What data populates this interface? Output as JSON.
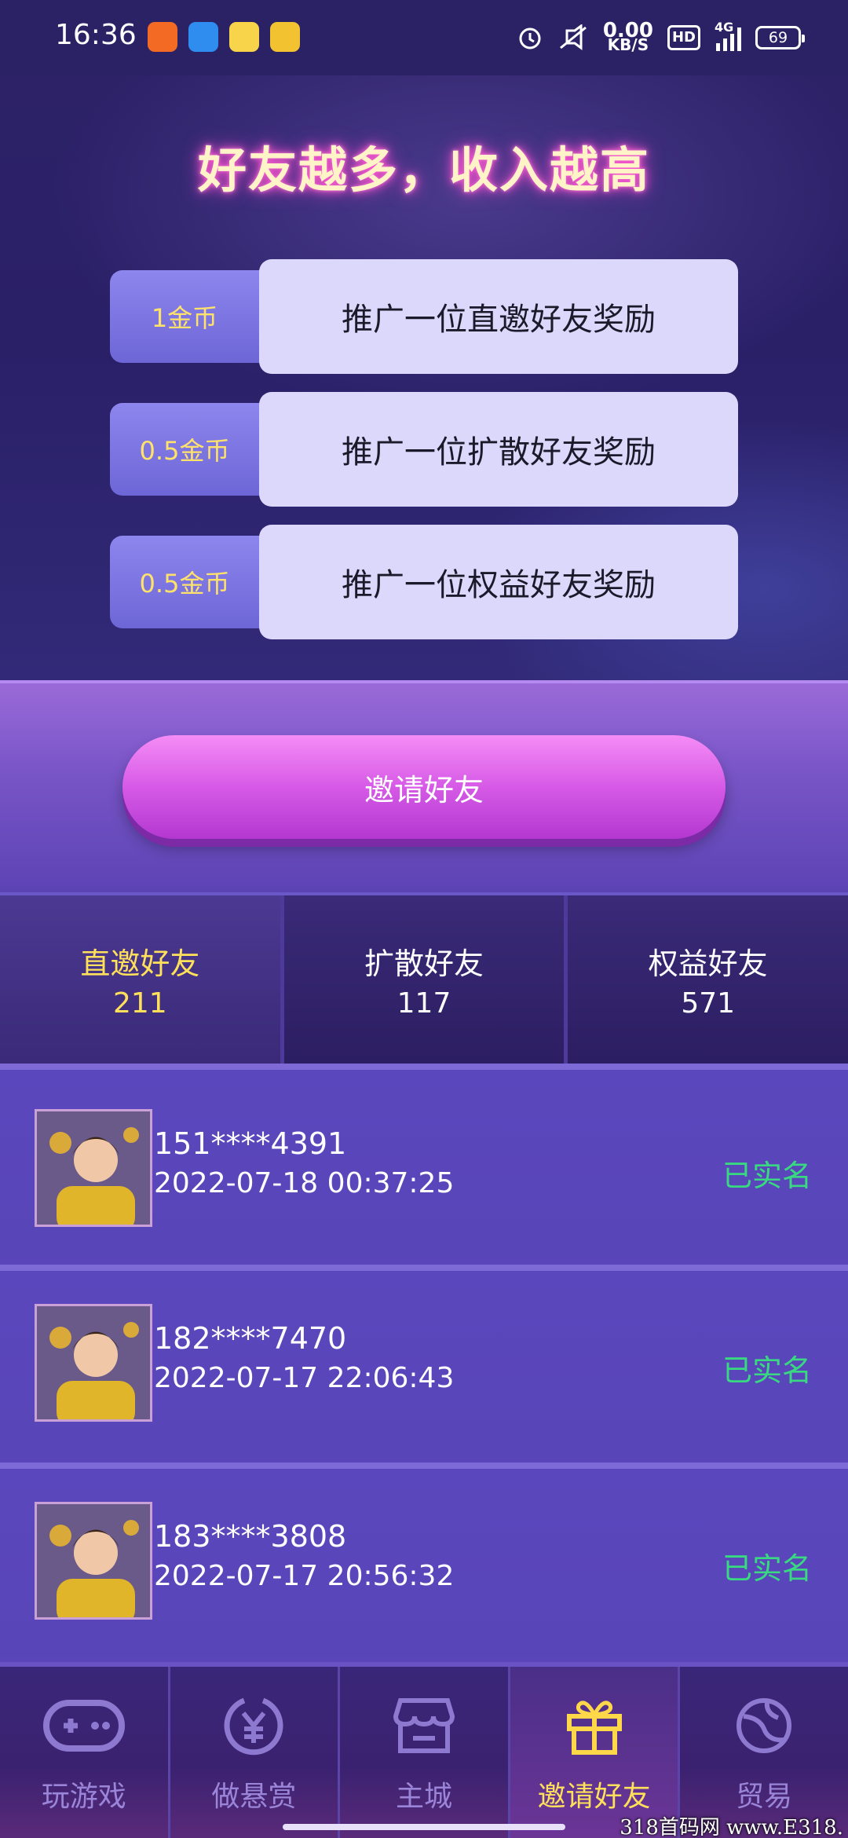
{
  "status_bar": {
    "time": "16:36",
    "speed_value": "0.00",
    "speed_unit": "KB/S",
    "hd": "HD",
    "network": "4G",
    "battery": "69"
  },
  "banner": {
    "title": "好友越多，收入越高",
    "rewards": [
      {
        "amount": "1金币",
        "text": "推广一位直邀好友奖励"
      },
      {
        "amount": "0.5金币",
        "text": "推广一位扩散好友奖励"
      },
      {
        "amount": "0.5金币",
        "text": "推广一位权益好友奖励"
      }
    ]
  },
  "invite_button": "邀请好友",
  "tabs": [
    {
      "label": "直邀好友",
      "count": "211"
    },
    {
      "label": "扩散好友",
      "count": "117"
    },
    {
      "label": "权益好友",
      "count": "571"
    }
  ],
  "friends": [
    {
      "phone": "151****4391",
      "time": "2022-07-18 00:37:25",
      "status": "已实名"
    },
    {
      "phone": "182****7470",
      "time": "2022-07-17 22:06:43",
      "status": "已实名"
    },
    {
      "phone": "183****3808",
      "time": "2022-07-17 20:56:32",
      "status": "已实名"
    }
  ],
  "nav": [
    {
      "label": "玩游戏",
      "icon": "gamepad-icon"
    },
    {
      "label": "做悬赏",
      "icon": "yen-coin-icon"
    },
    {
      "label": "主城",
      "icon": "store-icon"
    },
    {
      "label": "邀请好友",
      "icon": "gift-icon"
    },
    {
      "label": "贸易",
      "icon": "globe-icon"
    }
  ],
  "watermark": "318首码网 www.E318.",
  "colors": {
    "accent_yellow": "#ffe05a",
    "status_green": "#39d982",
    "invite_pink": "#d65ae6"
  }
}
